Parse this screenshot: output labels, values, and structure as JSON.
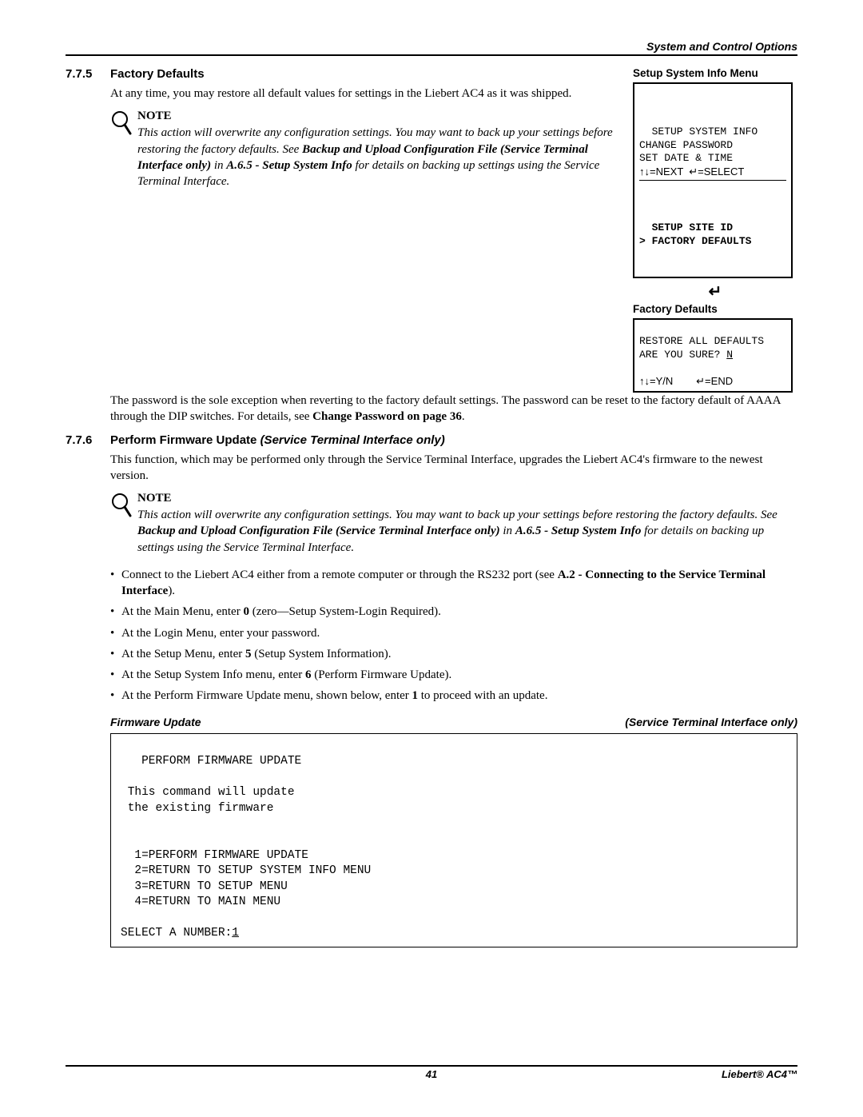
{
  "header": {
    "running": "System and Control Options"
  },
  "section775": {
    "num": "7.7.5",
    "title": "Factory Defaults",
    "para1": "At any time, you may restore all default values for settings in the Liebert AC4 as it was shipped.",
    "note_head": "NOTE",
    "note_body_1": "This action will overwrite any configuration settings. You may want to back up your settings before restoring the factory defaults. See ",
    "note_body_b1": "Backup and Upload Configuration File (Service Terminal Interface only)",
    "note_body_2": " in ",
    "note_body_b2": "A.6.5 - Setup System Info",
    "note_body_3": " for details on backing up settings using the Service Terminal Interface.",
    "para2_1": "The password is the sole exception when reverting to the factory default settings. The password can be reset to the factory default of AAAA through the DIP switches. For details, see ",
    "para2_b": "Change Password on page 36",
    "para2_2": "."
  },
  "sidebar": {
    "menu_label": "Setup System Info Menu",
    "lcd_top": {
      "l1": "  SETUP SYSTEM INFO",
      "l2": "CHANGE PASSWORD",
      "l3": "SET DATE & TIME",
      "l4": "↑↓=NEXT  ↵=SELECT"
    },
    "lcd_bottom": {
      "l1": "  SETUP SITE ID",
      "l2": "> FACTORY DEFAULTS"
    },
    "enter_glyph": "↵",
    "fd_label": "Factory Defaults",
    "lcd2": {
      "l1": "RESTORE ALL DEFAULTS",
      "l2a": "ARE YOU SURE? ",
      "l2b": "N",
      "blank": " ",
      "l3": "↑↓=Y/N        ↵=END"
    }
  },
  "section776": {
    "num": "7.7.6",
    "title_plain": "Perform Firmware Update ",
    "title_em": "(Service Terminal Interface only)",
    "para1": "This function, which may be performed only through the Service Terminal Interface, upgrades the Liebert AC4's firmware to the newest version.",
    "note_head": "NOTE",
    "note_body_1": "This action will overwrite any configuration settings. You may want to back up your settings before restoring the factory defaults. See ",
    "note_body_b1": "Backup and Upload Configuration File (Service Terminal Interface only)",
    "note_body_2": " in ",
    "note_body_b2": "A.6.5 - Setup System Info",
    "note_body_3": " for details on backing up settings using the Service Terminal Interface.",
    "bullets": {
      "b1a": "Connect to the Liebert AC4 either from a remote computer or through the RS232 port (see ",
      "b1b": "A.2 - Connecting to the Service Terminal Interface",
      "b1c": ").",
      "b2a": "At the Main Menu, enter ",
      "b2b": "0",
      "b2c": " (zero—Setup System-Login Required).",
      "b3": "At the Login Menu, enter your password.",
      "b4a": "At the Setup Menu, enter ",
      "b4b": "5",
      "b4c": " (Setup System Information).",
      "b5a": "At the Setup System Info menu, enter ",
      "b5b": "6",
      "b5c": " (Perform Firmware Update).",
      "b6a": "At the Perform Firmware Update menu, shown below, enter ",
      "b6b": "1",
      "b6c": " to proceed with an update."
    },
    "fw_title_left": "Firmware Update",
    "fw_title_right": "(Service Terminal Interface only)",
    "terminal": {
      "l1": "   PERFORM FIRMWARE UPDATE",
      "blank1": " ",
      "l2": " This command will update",
      "l3": " the existing firmware",
      "blank2": " ",
      "blank3": " ",
      "l4": "  1=PERFORM FIRMWARE UPDATE",
      "l5": "  2=RETURN TO SETUP SYSTEM INFO MENU",
      "l6": "  3=RETURN TO SETUP MENU",
      "l7": "  4=RETURN TO MAIN MENU",
      "blank4": " ",
      "l8a": "SELECT A NUMBER:",
      "l8b": "1"
    }
  },
  "footer": {
    "page": "41",
    "product": "Liebert® AC4™"
  }
}
